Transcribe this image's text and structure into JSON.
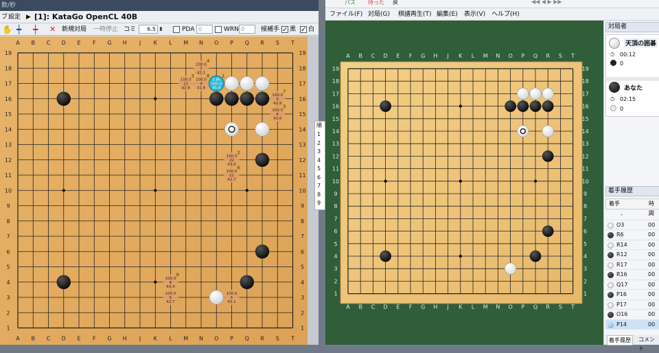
{
  "left_window": {
    "title": "数/秒",
    "toolbar1": {
      "label_prefix": "ブ",
      "settings": "設定",
      "arrow": "▶",
      "engine": "[1]: KataGo OpenCL 40B"
    },
    "toolbar2": {
      "new_game": "新規対局",
      "pause": "一時停止",
      "komi_label": "コミ",
      "komi_value": "6.5",
      "pda_label": "PDA",
      "pda_value": "0",
      "wrn_label": "WRN",
      "wrn_value": "0",
      "candidate_label": "候補手",
      "black_label": "黒",
      "white_label": "白"
    },
    "board": {
      "columns": [
        "A",
        "B",
        "C",
        "D",
        "E",
        "F",
        "G",
        "H",
        "J",
        "K",
        "L",
        "M",
        "N",
        "O",
        "P",
        "Q",
        "R",
        "S",
        "T"
      ],
      "rows": [
        "19",
        "18",
        "17",
        "16",
        "15",
        "14",
        "13",
        "12",
        "11",
        "10",
        "9",
        "8",
        "7",
        "6",
        "5",
        "4",
        "3",
        "2",
        "1"
      ],
      "black_stones": [
        "D16",
        "O16",
        "P16",
        "Q16",
        "R16",
        "R12",
        "R6",
        "D4",
        "Q4"
      ],
      "white_stones": [
        "P17",
        "Q17",
        "R17",
        "R14",
        "P14",
        "O3"
      ],
      "last_move": "P14",
      "hoshi": [
        "D16",
        "K16",
        "Q16",
        "D10",
        "K10",
        "Q10",
        "D4",
        "K4",
        "Q4"
      ],
      "candidates": [
        {
          "pt": "O17",
          "lines": [
            "3.8k",
            "100.0",
            "45.8"
          ],
          "order": "1",
          "current": true
        },
        {
          "pt": "N17",
          "lines": [
            "100.0",
            "9",
            "41.6"
          ],
          "order": "8"
        },
        {
          "pt": "N18",
          "lines": [
            "100.0",
            "7",
            "42.1"
          ],
          "order": "4"
        },
        {
          "pt": "M17",
          "lines": [
            "100.0",
            "11",
            "42.6"
          ],
          "order": "3"
        },
        {
          "pt": "S16",
          "lines": [
            "100.0",
            "5",
            "42.8"
          ],
          "order": "7"
        },
        {
          "pt": "S15",
          "lines": [
            "100.0",
            "6",
            "43.6"
          ],
          "order": "5"
        },
        {
          "pt": "P12",
          "lines": [
            "100.0",
            "22",
            "43.6"
          ],
          "order": "2"
        },
        {
          "pt": "P11",
          "lines": [
            "100.0",
            "11",
            "42.7"
          ],
          "order": "6"
        },
        {
          "pt": "L4",
          "lines": [
            "100.0",
            "6",
            "43.4"
          ],
          "order": "9"
        },
        {
          "pt": "L3",
          "lines": [
            "100.0",
            "5",
            "42.7"
          ],
          "order": ""
        },
        {
          "pt": "P3",
          "lines": [
            "100.0",
            "5",
            "43.1"
          ],
          "order": ""
        }
      ]
    },
    "side_panel_numbers": [
      "1",
      "2",
      "3",
      "4",
      "5",
      "6",
      "7",
      "8",
      "9"
    ],
    "side_panel_label": "順"
  },
  "right_window": {
    "toolbar_items": [
      "パス",
      "待った",
      "戻"
    ],
    "menu": [
      "ファイル(F)",
      "対局(G)",
      "棋譜再生(T)",
      "編集(E)",
      "表示(V)",
      "ヘルプ(H)"
    ],
    "board": {
      "columns": [
        "A",
        "B",
        "C",
        "D",
        "E",
        "F",
        "G",
        "H",
        "J",
        "K",
        "L",
        "M",
        "N",
        "O",
        "P",
        "Q",
        "R",
        "S",
        "T"
      ],
      "rows": [
        "19",
        "18",
        "17",
        "16",
        "15",
        "14",
        "13",
        "12",
        "11",
        "10",
        "9",
        "8",
        "7",
        "6",
        "5",
        "4",
        "3",
        "2",
        "1"
      ],
      "black_stones": [
        "D16",
        "O16",
        "P16",
        "Q16",
        "R16",
        "R12",
        "R6",
        "D4",
        "Q4"
      ],
      "white_stones": [
        "P17",
        "Q17",
        "R17",
        "R14",
        "P14",
        "O3"
      ],
      "last_move": "P14"
    },
    "players_header": "対局者",
    "player_white": {
      "name": "天頂の囲碁",
      "time": "00:12",
      "captures": "0"
    },
    "player_black": {
      "name": "あなた",
      "time": "02:15",
      "captures": "0"
    },
    "history_header": "着手履歴",
    "history_columns": [
      "着手",
      "時間"
    ],
    "history": [
      {
        "color": "none",
        "move": "-",
        "time": "-"
      },
      {
        "color": "white",
        "move": "O3",
        "time": "00"
      },
      {
        "color": "black",
        "move": "R6",
        "time": "00"
      },
      {
        "color": "white",
        "move": "R14",
        "time": "00"
      },
      {
        "color": "black",
        "move": "R12",
        "time": "00"
      },
      {
        "color": "white",
        "move": "R17",
        "time": "00"
      },
      {
        "color": "black",
        "move": "R16",
        "time": "00"
      },
      {
        "color": "white",
        "move": "Q17",
        "time": "00"
      },
      {
        "color": "black",
        "move": "P16",
        "time": "00"
      },
      {
        "color": "white",
        "move": "P17",
        "time": "00"
      },
      {
        "color": "black",
        "move": "O16",
        "time": "00"
      },
      {
        "color": "current",
        "move": "P14",
        "time": "00"
      }
    ],
    "bottom_tabs": [
      "着手履歴",
      "コメント"
    ]
  }
}
